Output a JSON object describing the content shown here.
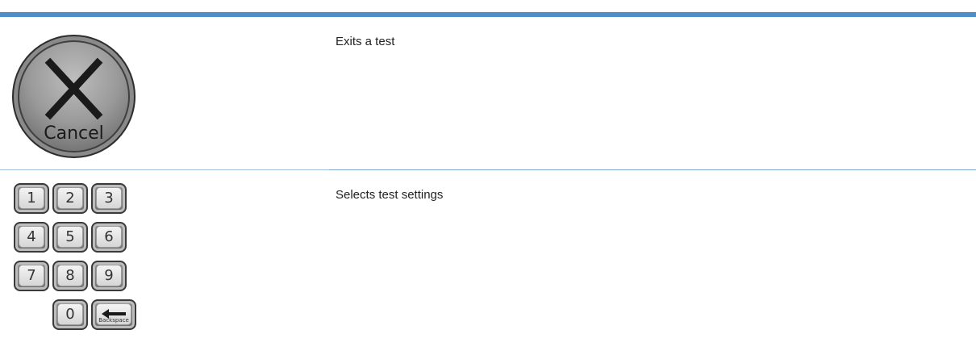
{
  "rows": [
    {
      "icon": "cancel-button-icon",
      "icon_label": "Cancel",
      "description": "Exits a test"
    },
    {
      "icon": "numeric-keypad-icon",
      "description": "Selects test settings",
      "keypad": {
        "keys": [
          "1",
          "2",
          "3",
          "4",
          "5",
          "6",
          "7",
          "8",
          "9",
          "0"
        ],
        "backspace_label": "Backspace"
      }
    }
  ],
  "colors": {
    "header_bar": "#4f8fc9",
    "divider": "#7fa6cc"
  }
}
